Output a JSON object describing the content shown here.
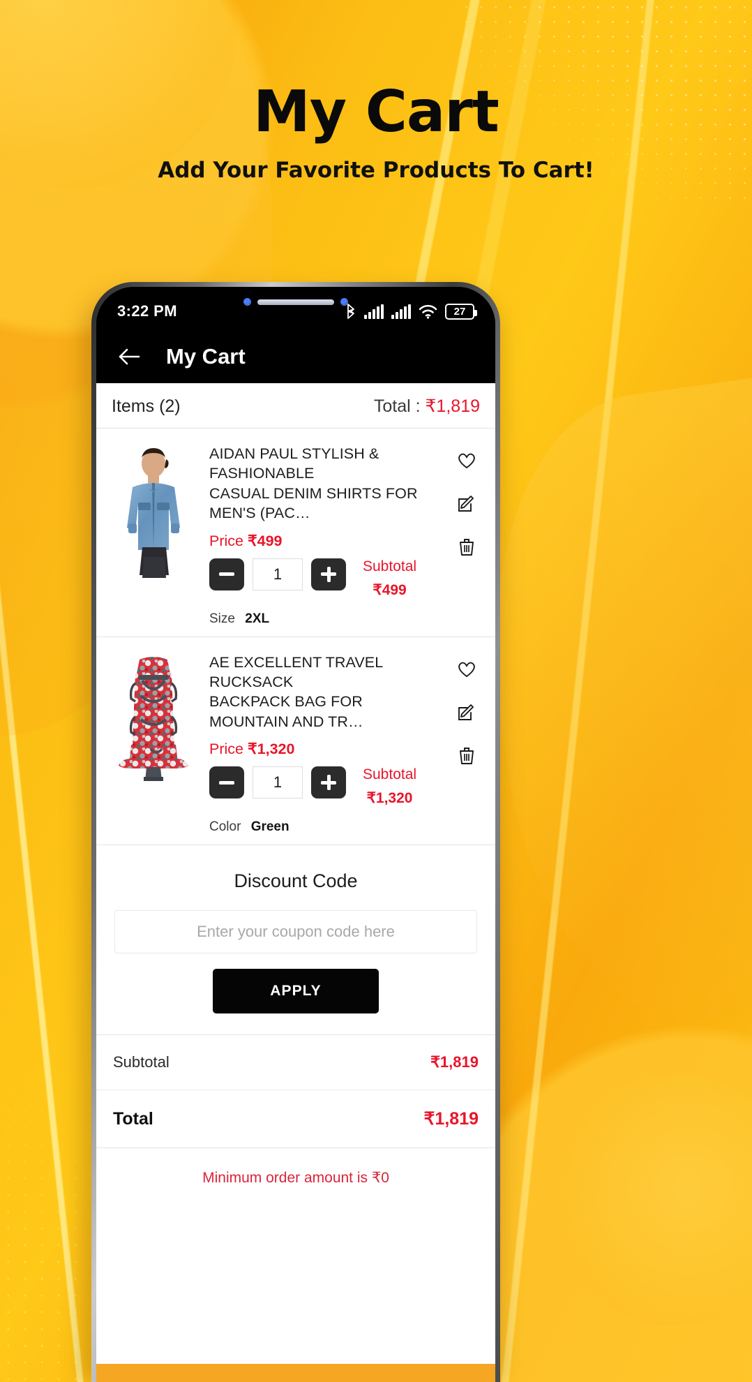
{
  "banner": {
    "title": "My Cart",
    "subtitle": "Add Your Favorite Products To Cart!"
  },
  "colors": {
    "background": "#FBB711",
    "accent_red": "#E8152A",
    "button_dark": "#050505",
    "bottom_bar": "#F5A623"
  },
  "phone": {
    "statusbar": {
      "time": "3:22 PM",
      "battery_percent": "27",
      "icons": [
        "bluetooth-icon",
        "signal-icon",
        "signal-icon",
        "wifi-icon",
        "battery-icon"
      ]
    },
    "appbar": {
      "back_icon": "arrow-left-icon",
      "title": "My Cart"
    },
    "summary_bar": {
      "items_label": "Items (2)",
      "total_prefix": "Total : ",
      "total_value": "₹1,819"
    },
    "cart_items": [
      {
        "thumb": "denim-shirt-image",
        "title": "AIDAN PAUL STYLISH & FASHIONABLE\nCASUAL DENIM SHIRTS FOR MEN'S (PAC…",
        "price_label": "Price",
        "price_value": "₹499",
        "decrement_label": "−",
        "increment_label": "+",
        "quantity": "1",
        "subtotal_label": "Subtotal",
        "subtotal_value": "₹499",
        "attribute_label": "Size",
        "attribute_value": "2XL",
        "actions": [
          "heart-icon",
          "edit-icon",
          "trash-icon"
        ]
      },
      {
        "thumb": "rucksack-backpack-image",
        "title": "AE EXCELLENT TRAVEL RUCKSACK\nBACKPACK BAG FOR MOUNTAIN AND TR…",
        "price_label": "Price",
        "price_value": "₹1,320",
        "decrement_label": "−",
        "increment_label": "+",
        "quantity": "1",
        "subtotal_label": "Subtotal",
        "subtotal_value": "₹1,320",
        "attribute_label": "Color",
        "attribute_value": "Green",
        "actions": [
          "heart-icon",
          "edit-icon",
          "trash-icon"
        ]
      }
    ],
    "discount": {
      "title": "Discount Code",
      "input_value": "",
      "input_placeholder": "Enter your coupon code here",
      "apply_label": "APPLY"
    },
    "totals": {
      "subtotal_label": "Subtotal",
      "subtotal_value": "₹1,819",
      "total_label": "Total",
      "total_value": "₹1,819"
    },
    "notice": "Minimum order amount is ₹0"
  }
}
